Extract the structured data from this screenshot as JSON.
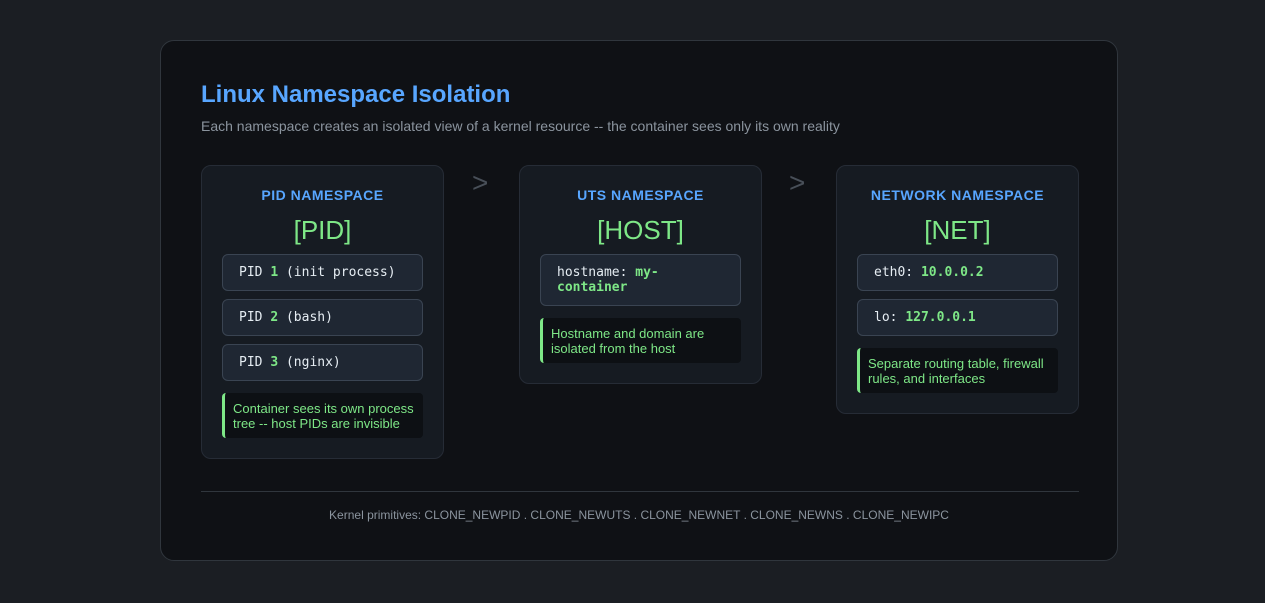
{
  "title": "Linux Namespace Isolation",
  "subtitle": "Each namespace creates an isolated view of a kernel resource -- the container sees only its own reality",
  "arrow_glyph": ">",
  "cards": [
    {
      "title": "PID NAMESPACE",
      "tag": "[PID]",
      "rows": [
        {
          "pre": "PID ",
          "value": "1",
          "post": " (init process)"
        },
        {
          "pre": "PID ",
          "value": "2",
          "post": " (bash)"
        },
        {
          "pre": "PID ",
          "value": "3",
          "post": " (nginx)"
        }
      ],
      "note": "Container sees its own process tree -- host PIDs are invisible"
    },
    {
      "title": "UTS NAMESPACE",
      "tag": "[HOST]",
      "rows": [
        {
          "pre": "hostname: ",
          "value": "my-container",
          "post": ""
        }
      ],
      "note": "Hostname and domain are isolated from the host"
    },
    {
      "title": "NETWORK NAMESPACE",
      "tag": "[NET]",
      "rows": [
        {
          "pre": "eth0: ",
          "value": "10.0.0.2",
          "post": ""
        },
        {
          "pre": "lo: ",
          "value": "127.0.0.1",
          "post": ""
        }
      ],
      "note": "Separate routing table, firewall rules, and interfaces"
    }
  ],
  "footer": "Kernel primitives: CLONE_NEWPID . CLONE_NEWUTS . CLONE_NEWNET . CLONE_NEWNS . CLONE_NEWIPC"
}
